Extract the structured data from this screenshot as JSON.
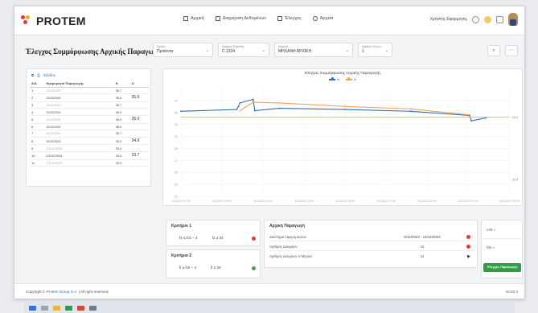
{
  "app": {
    "brand": "PROTEM"
  },
  "nav": [
    {
      "label": "Αρχική"
    },
    {
      "label": "Διαχείριση Δεδομένων"
    },
    {
      "label": "Έλεγχος"
    },
    {
      "label": "Αρχεία"
    }
  ],
  "user": {
    "name": "Χρήστης Εφαρμογής"
  },
  "page": {
    "title": "Έλεγχος Συμμόρφωσης Αρχικής Παραγωγής"
  },
  "filters": [
    {
      "label": "Προϊόν",
      "value": "Προϊόντα"
    },
    {
      "label": "Αριθμός Παρτίδας",
      "value": "C.1234"
    },
    {
      "label": "Μηχανή",
      "value": "ΜΗΧΑΝΗ ΑΡΧΙΚΗ"
    },
    {
      "label": "Αριθμός Κελιού",
      "value": "1"
    }
  ],
  "table": {
    "tools": [
      "Έξοδος"
    ],
    "headers": [
      "Α/Α",
      "Ημερομηνία Παραγωγής",
      "Ν",
      "Ω"
    ],
    "rows": [
      {
        "n": "1",
        "date": "3/12/2024",
        "v": "35,7",
        "avg": ""
      },
      {
        "n": "2",
        "date": "3/12/2024",
        "v": "35,6",
        "avg": "35,6"
      },
      {
        "n": "3",
        "date": "3/12/2024",
        "v": "35,7",
        "avg": ""
      },
      {
        "n": "4",
        "date": "3/12/2024",
        "v": "36,0",
        "avg": ""
      },
      {
        "n": "5",
        "date": "3/12/2024",
        "v": "35,9",
        "avg": "36,0"
      },
      {
        "n": "6",
        "date": "3/12/2024",
        "v": "36,0",
        "avg": ""
      },
      {
        "n": "7",
        "date": "3/12/2024",
        "v": "35,7",
        "avg": ""
      },
      {
        "n": "8",
        "date": "3/12/2024",
        "v": "35,9",
        "avg": "34,9"
      },
      {
        "n": "9",
        "date": "13/12/2024",
        "v": "33,4",
        "avg": ""
      },
      {
        "n": "10",
        "date": "13/12/2024",
        "v": "33,6",
        "avg": "33,7"
      },
      {
        "n": "11",
        "date": "13/12/2024",
        "v": "33,9",
        "avg": ""
      }
    ]
  },
  "chart": {
    "title": "Έλεγχος Συμμόρφωσης Αρχικής Παραγωγής",
    "legend": [
      "Ν",
      "Ω"
    ],
    "threshold_label": "33,4",
    "threshold_label_2": "33,4",
    "colors": {
      "n": "#2f6db5",
      "w": "#f0a35e"
    }
  },
  "chart_data": {
    "type": "line",
    "title": "Έλεγχος Συμμόρφωσης Αρχικής Παραγωγής",
    "xlabel": "",
    "ylabel": "",
    "x": [
      "3/12/2024 07:00",
      "3/12/2024 09:00",
      "3/12/2024 11:00",
      "3/12/2024 13:00",
      "3/12/2024 15:00",
      "3/12/2024 17:00",
      "3/12/2024 19:00",
      "13/12/2024 07:00",
      "13/12/2024 09:00"
    ],
    "ylim": [
      21,
      39
    ],
    "yticks": [
      21,
      23,
      25,
      27,
      29,
      31,
      33,
      35,
      37
    ],
    "series": [
      {
        "name": "Ν",
        "color": "#2f6db5",
        "points": [
          [
            0.0,
            35.2
          ],
          [
            0.17,
            35.5
          ],
          [
            0.175,
            36.0
          ],
          [
            0.18,
            36.6
          ],
          [
            0.22,
            37.2
          ],
          [
            0.225,
            35.3
          ],
          [
            0.3,
            35.7
          ],
          [
            0.5,
            35.5
          ],
          [
            0.7,
            35.2
          ],
          [
            0.88,
            34.5
          ],
          [
            0.885,
            33.6
          ],
          [
            0.93,
            34.1
          ]
        ]
      },
      {
        "name": "Ω",
        "color": "#f0a35e",
        "points": [
          [
            0.18,
            35.3
          ],
          [
            0.22,
            36.7
          ],
          [
            0.3,
            36.6
          ],
          [
            0.5,
            36.0
          ],
          [
            0.7,
            35.6
          ],
          [
            0.88,
            34.6
          ]
        ]
      },
      {
        "name": "",
        "color": "#f0a35e",
        "points": [
          [
            0.0,
            34.2
          ],
          [
            1.0,
            34.2
          ]
        ]
      }
    ]
  },
  "criteria": [
    {
      "title": "Κριτήριο 1",
      "a": "f1 ≤ fck − 4",
      "b": "f1 ≥ 34",
      "status": "fail"
    },
    {
      "title": "Κριτήριο 2",
      "a": "fi ≥ fck − 4",
      "b": "fi ≥ 26",
      "status": "pass"
    }
  ],
  "production": {
    "title": "Αρχική Παραγωγή",
    "rows": [
      {
        "label": "Διάστημα Ημερομηνιών",
        "value": "3/12/2024 - 13/12/2024",
        "mark": "fail"
      },
      {
        "label": "Αριθμός Δοκιμίων",
        "value": "11",
        "mark": "fail"
      },
      {
        "label": "Αριθμός Δοκιμίων 3 Μηνών",
        "value": "11",
        "mark": "play"
      }
    ]
  },
  "side": {
    "line1": "c25 ≈",
    "line2": "f35 ≈",
    "button": "Έλεγχος Παραγωγής"
  },
  "footer": {
    "copy_prefix": "Copyright ©",
    "company": "Protem Group S.A.",
    "copy_suffix": "| All right reserved.",
    "version": "v0.03.4"
  }
}
